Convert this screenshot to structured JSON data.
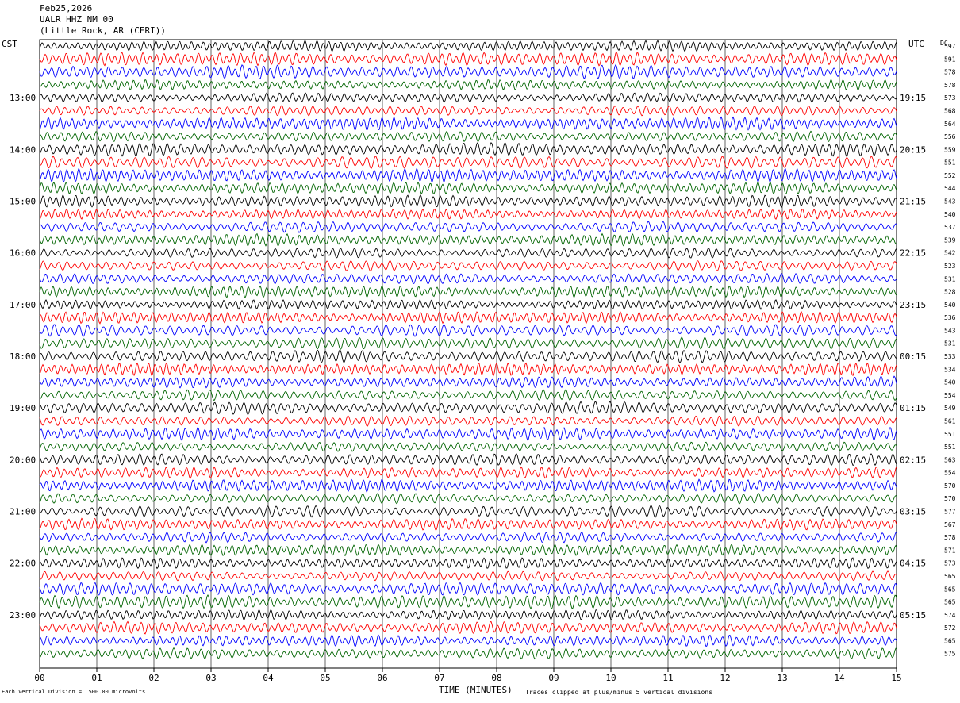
{
  "header": {
    "date": "Feb25,2026",
    "station": "UALR HHZ NM 00",
    "location": "(Little Rock, AR (CERI))"
  },
  "left_zone": "CST",
  "right_zone": "UTC",
  "dc_label": "DC",
  "footer": {
    "scale_note": "Each Vertical Division =  500.00 microvolts",
    "xlabel": "TIME (MINUTES)",
    "clip_note": "Traces clipped at plus/minus 5 vertical divisions"
  },
  "chart_data": {
    "type": "line",
    "title": "",
    "xlabel": "TIME (MINUTES)",
    "xlim": [
      0,
      15
    ],
    "x_ticks": [
      "00",
      "01",
      "02",
      "03",
      "04",
      "05",
      "06",
      "07",
      "08",
      "09",
      "10",
      "11",
      "12",
      "13",
      "14",
      "15"
    ],
    "trace_colors": [
      "#000000",
      "#ff0000",
      "#0000ff",
      "#006400"
    ],
    "trace_count": 48,
    "hour_labels_cst": [
      "13:00",
      "14:00",
      "15:00",
      "16:00",
      "17:00",
      "18:00",
      "19:00",
      "20:00",
      "21:00",
      "22:00",
      "23:00"
    ],
    "hour_labels_utc": [
      "19:15",
      "20:15",
      "21:15",
      "22:15",
      "23:15",
      "00:15",
      "01:15",
      "02:15",
      "03:15",
      "04:15",
      "05:15"
    ],
    "dc_offsets": [
      "597",
      "591",
      "578",
      "578",
      "573",
      "568",
      "564",
      "556",
      "559",
      "551",
      "552",
      "544",
      "543",
      "540",
      "537",
      "539",
      "542",
      "523",
      "531",
      "528",
      "540",
      "536",
      "543",
      "531",
      "533",
      "534",
      "540",
      "554",
      "549",
      "561",
      "551",
      "551",
      "563",
      "554",
      "570",
      "570",
      "577",
      "567",
      "578",
      "571",
      "573",
      "565",
      "565",
      "565",
      "574",
      "572",
      "565",
      "575"
    ]
  }
}
